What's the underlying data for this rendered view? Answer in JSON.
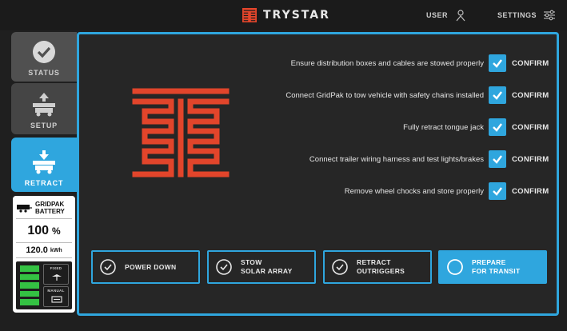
{
  "app": {
    "brand": "TRYSTAR"
  },
  "topbar": {
    "user_label": "USER",
    "settings_label": "SETTINGS"
  },
  "sidebar": {
    "items": [
      {
        "label": "STATUS",
        "icon": "check-circle-icon",
        "active": false
      },
      {
        "label": "SETUP",
        "icon": "setup-trailer-icon",
        "active": false
      },
      {
        "label": "RETRACT",
        "icon": "retract-trailer-icon",
        "active": true
      }
    ],
    "battery": {
      "title_line1": "GRIDPAK",
      "title_line2": "BATTERY",
      "percent": "100",
      "percent_unit": "%",
      "energy": "120.0",
      "energy_unit": "kWh",
      "bars_filled": 5,
      "modes": [
        {
          "label": "FIXED",
          "icon": "fixed-mount-icon"
        },
        {
          "label": "MANUAL",
          "icon": "manual-mode-icon"
        }
      ]
    }
  },
  "checklist": [
    {
      "text": "Ensure distribution boxes and cables are stowed properly",
      "confirm_label": "CONFIRM",
      "checked": true
    },
    {
      "text": "Connect GridPak to tow vehicle with safety chains installed",
      "confirm_label": "CONFIRM",
      "checked": true
    },
    {
      "text": "Fully retract tongue jack",
      "confirm_label": "CONFIRM",
      "checked": true
    },
    {
      "text": "Connect trailer wiring harness and test lights/brakes",
      "confirm_label": "CONFIRM",
      "checked": true
    },
    {
      "text": "Remove wheel chocks and store properly",
      "confirm_label": "CONFIRM",
      "checked": true
    }
  ],
  "actions": [
    {
      "line1": "POWER DOWN",
      "line2": "",
      "done": true
    },
    {
      "line1": "STOW",
      "line2": "SOLAR ARRAY",
      "done": true
    },
    {
      "line1": "RETRACT",
      "line2": "OUTRIGGERS",
      "done": true
    },
    {
      "line1": "PREPARE",
      "line2": "FOR TRANSIT",
      "done": false
    }
  ],
  "colors": {
    "accent": "#2fa6de",
    "brand_red": "#e2452b",
    "battery_green": "#34c243",
    "background": "#1f1f1f"
  }
}
